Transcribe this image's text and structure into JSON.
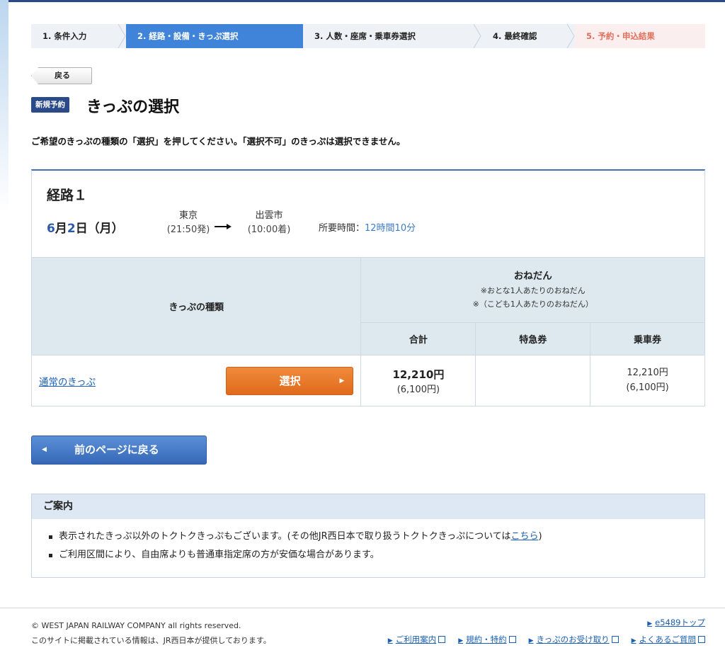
{
  "steps": [
    {
      "label": "1. 条件入力"
    },
    {
      "label": "2. 経路・設備・きっぷ選択"
    },
    {
      "label": "3. 人数・座席・乗車券選択"
    },
    {
      "label": "4. 最終確認"
    },
    {
      "label": "5. 予約・申込結果"
    }
  ],
  "back_label": "戻る",
  "badge": "新規予約",
  "page_title": "きっぷの選択",
  "instruction": "ご希望のきっぷの種類の「選択」を押してください。「選択不可」のきっぷは選択できません。",
  "route": {
    "title": "経路１",
    "date_month": "6",
    "date_month_suffix": "月",
    "date_day": "2",
    "date_day_suffix": "日（月）",
    "departure": {
      "station": "東京",
      "time": "(21:50発)"
    },
    "arrival": {
      "station": "出雲市",
      "time": "(10:00着)"
    },
    "duration_label": "所要時間：",
    "duration_value": "12時間10分"
  },
  "table": {
    "kind_header": "きっぷの種類",
    "price_header": "おねだん",
    "price_note_adult": "※おとな1人あたりのおねだん",
    "price_note_child": "※（こども1人あたりのおねだん）",
    "col_total": "合計",
    "col_express": "特急券",
    "col_fare": "乗車券",
    "rows": [
      {
        "ticket": "通常のきっぷ",
        "select": "選択",
        "total": "12,210円",
        "total_child": "(6,100円)",
        "express": "",
        "fare": "12,210円",
        "fare_child": "(6,100円)"
      }
    ]
  },
  "prev_page": "前のページに戻る",
  "info": {
    "title": "ご案内",
    "item1_text": "表示されたきっぷ以外のトクトクきっぷもございます。(その他JR西日本で取り扱うトクトクきっぷについては",
    "item1_link": "こちら",
    "item1_end": ")",
    "item2": "ご利用区間により、自由席よりも普通車指定席の方が安価な場合があります。"
  },
  "footer": {
    "copyright": "© WEST JAPAN RAILWAY COMPANY all rights reserved.",
    "note": "このサイトに掲載されている情報は、JR西日本が提供しております。",
    "top_link": "e5489トップ",
    "links": [
      "ご利用案内",
      "規約・特約",
      "きっぷのお受け取り",
      "よくあるご質問"
    ]
  }
}
